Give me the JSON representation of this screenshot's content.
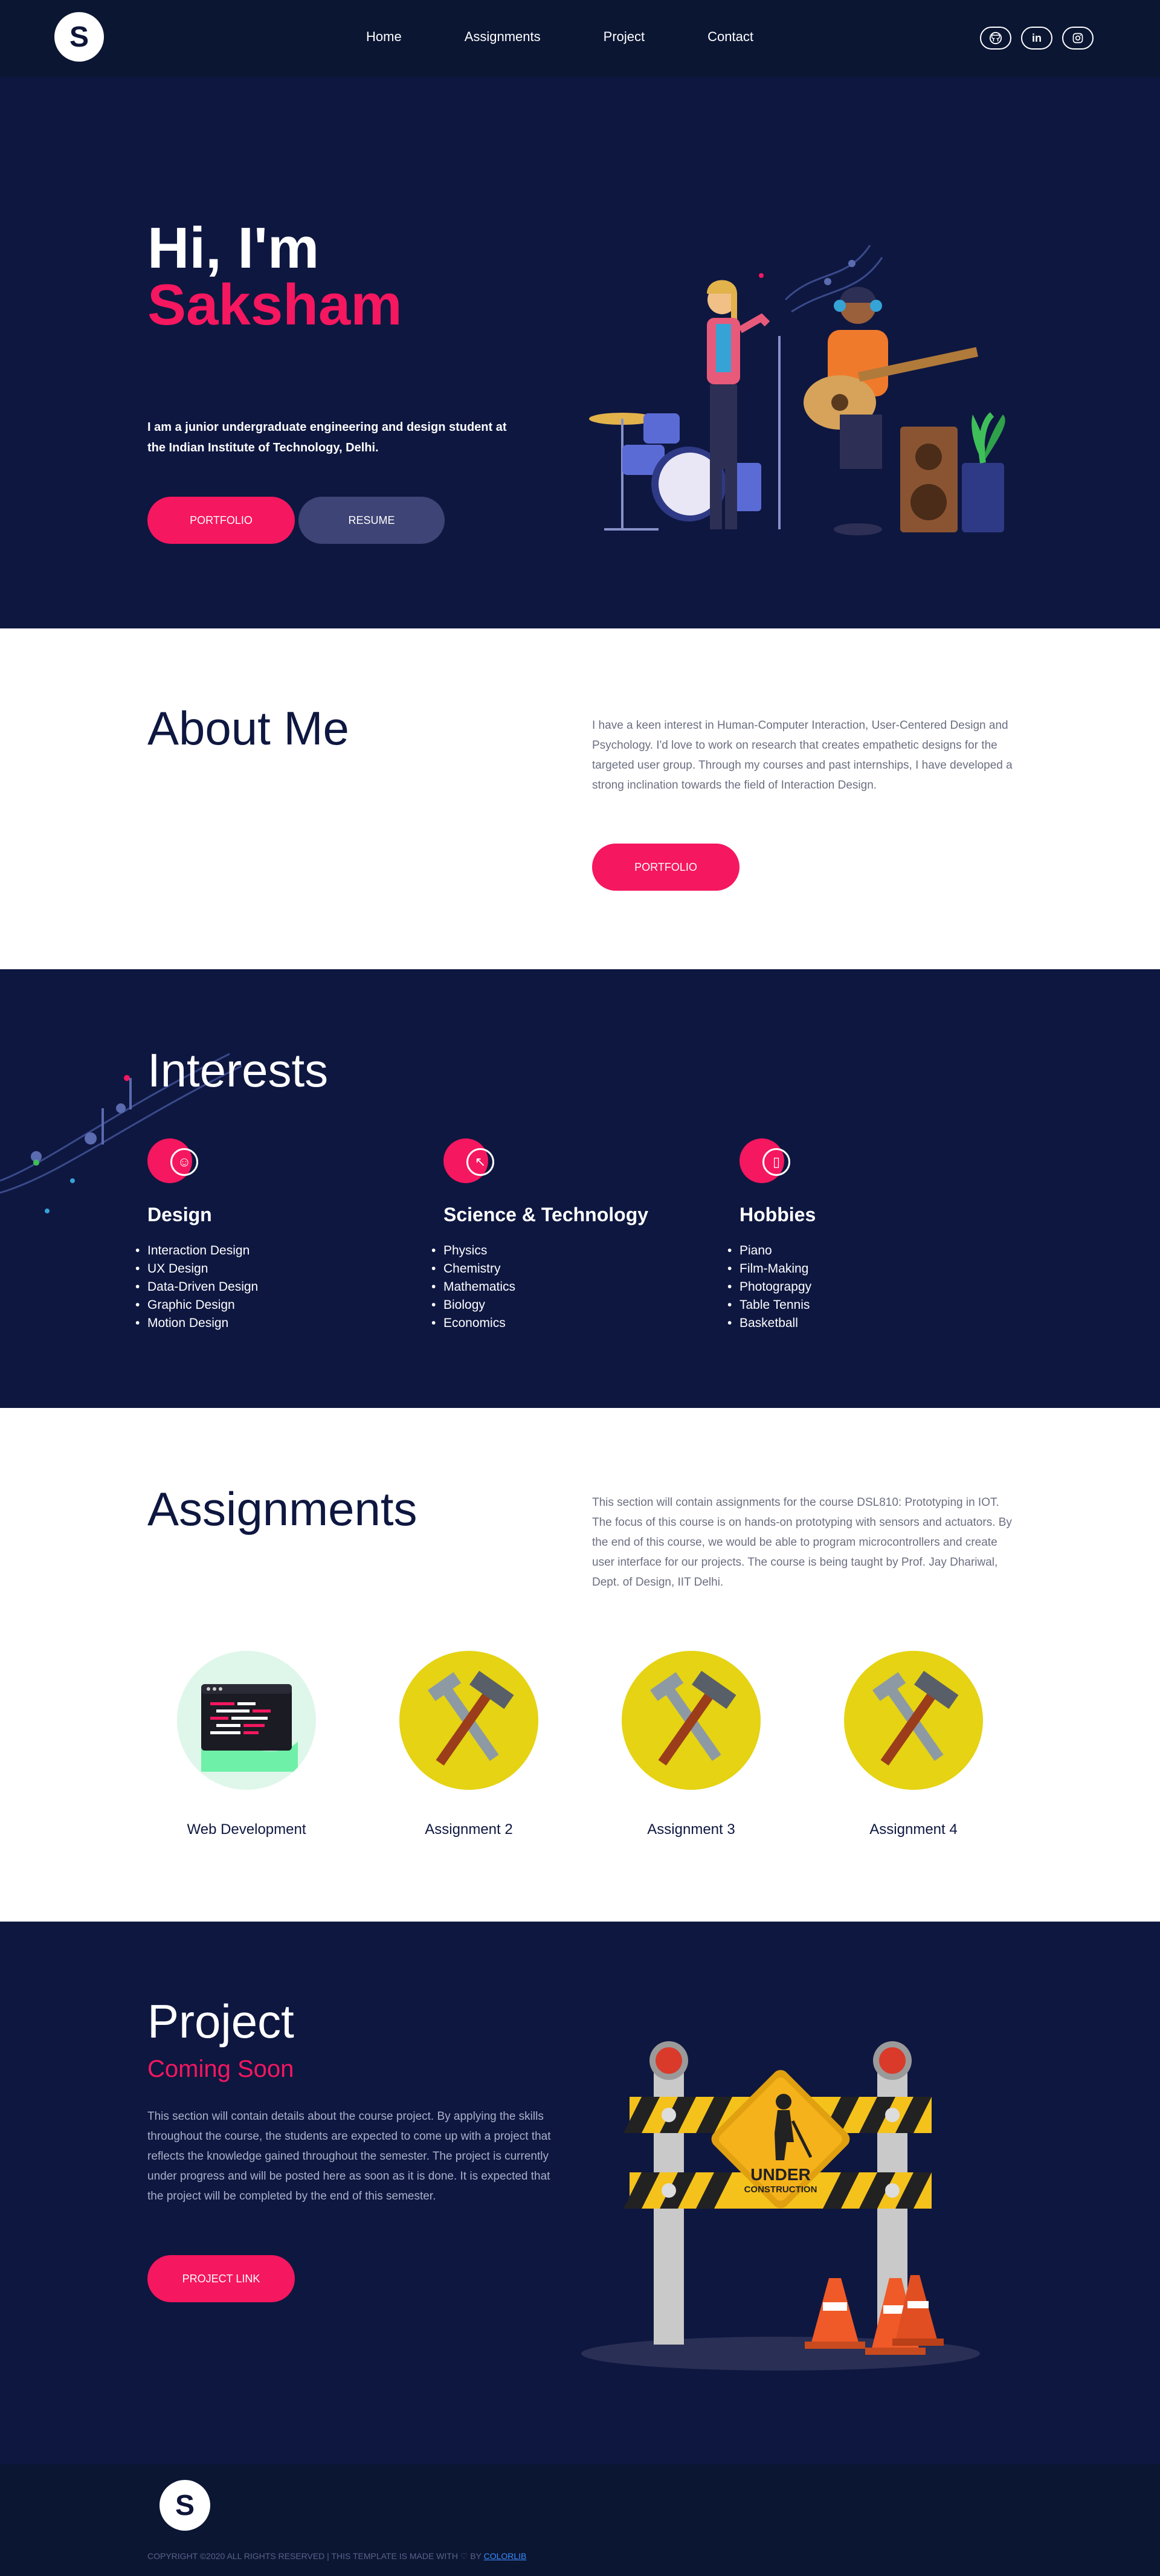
{
  "nav": {
    "logo": "S",
    "items": [
      "Home",
      "Assignments",
      "Project",
      "Contact"
    ],
    "social": [
      "GH",
      "in",
      "IG"
    ]
  },
  "hero": {
    "greeting": "Hi, I'm",
    "name": "Saksham",
    "intro": "I am a junior undergraduate engineering and design student at the Indian Institute of Technology, Delhi.",
    "btn_portfolio": "PORTFOLIO",
    "btn_resume": "RESUME"
  },
  "about": {
    "title": "About Me",
    "text": "I have a keen interest in Human-Computer Interaction, User-Centered Design and Psychology. I'd love to work on research that creates empathetic designs for the targeted user group. Through my courses and past internships, I have developed a strong inclination towards the field of Interaction Design.",
    "btn": "PORTFOLIO"
  },
  "interests": {
    "title": "Interests",
    "columns": [
      {
        "title": "Design",
        "items": [
          "Interaction Design",
          "UX Design",
          "Data-Driven Design",
          "Graphic Design",
          "Motion Design"
        ]
      },
      {
        "title": "Science & Technology",
        "items": [
          "Physics",
          "Chemistry",
          "Mathematics",
          "Biology",
          "Economics"
        ]
      },
      {
        "title": "Hobbies",
        "items": [
          "Piano",
          "Film-Making",
          "Photograpgy",
          "Table Tennis",
          "Basketball"
        ]
      }
    ]
  },
  "assignments": {
    "title": "Assignments",
    "text": "This section will contain assignments for the course DSL810: Prototyping in IOT. The focus of this course is on hands-on prototyping with sensors and actuators. By the end of this course, we would be able to program microcontrollers and create user interface for our projects. The course is being taught by Prof. Jay Dhariwal, Dept. of Design, IIT Delhi.",
    "cards": [
      "Web Development",
      "Assignment 2",
      "Assignment 3",
      "Assignment 4"
    ]
  },
  "project": {
    "title": "Project",
    "subtitle": "Coming Soon",
    "text": "This section will contain details about the course project. By applying the skills throughout the course, the students are expected to come up with a project that reflects the knowledge gained throughout the semester. The project is currently under progress and will be posted here as soon as it is done. It is expected that the project will be completed by the end of this semester.",
    "btn": "PROJECT LINK",
    "sign_text_1": "UNDER",
    "sign_text_2": "CONSTRUCTION"
  },
  "footer": {
    "logo": "S",
    "copyright": "COPYRIGHT ©2020 ALL RIGHTS RESERVED | THIS TEMPLATE IS MADE WITH ♡ BY",
    "credit": "COLORLIB"
  },
  "colors": {
    "accent": "#f5175f",
    "navy": "#0e1740",
    "button_grey": "#3e4475"
  }
}
